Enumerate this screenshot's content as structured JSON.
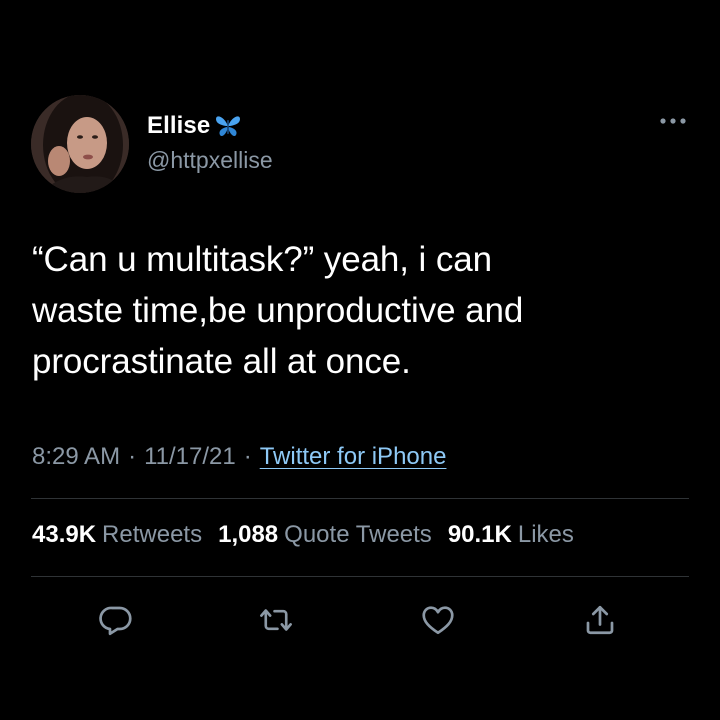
{
  "author": {
    "display_name": "Ellise",
    "handle": "@httpxellise",
    "badge_icon": "butterfly-emoji-icon",
    "avatar": "profile-photo"
  },
  "menu_icon": "more-horizontal-icon",
  "tweet": {
    "text": "“Can u multitask?” yeah, i can\nwaste time,be unproductive and\nprocrastinate all at once."
  },
  "meta": {
    "time": "8:29 AM",
    "separator1": "·",
    "date": "11/17/21",
    "separator2": "·",
    "source": "Twitter for iPhone"
  },
  "stats": [
    {
      "value": "43.9K",
      "label": "Retweets"
    },
    {
      "value": "1,088",
      "label": "Quote Tweets"
    },
    {
      "value": "90.1K",
      "label": "Likes"
    }
  ],
  "actions": [
    {
      "name": "reply",
      "icon": "reply-icon"
    },
    {
      "name": "retweet",
      "icon": "retweet-icon"
    },
    {
      "name": "like",
      "icon": "heart-icon"
    },
    {
      "name": "share",
      "icon": "share-icon"
    }
  ],
  "colors": {
    "background": "#000000",
    "primary_text": "#ffffff",
    "secondary_text": "#8b98a5",
    "link": "#8ec9f6",
    "divider": "#2f3336",
    "badge": "#4aa3f0"
  }
}
